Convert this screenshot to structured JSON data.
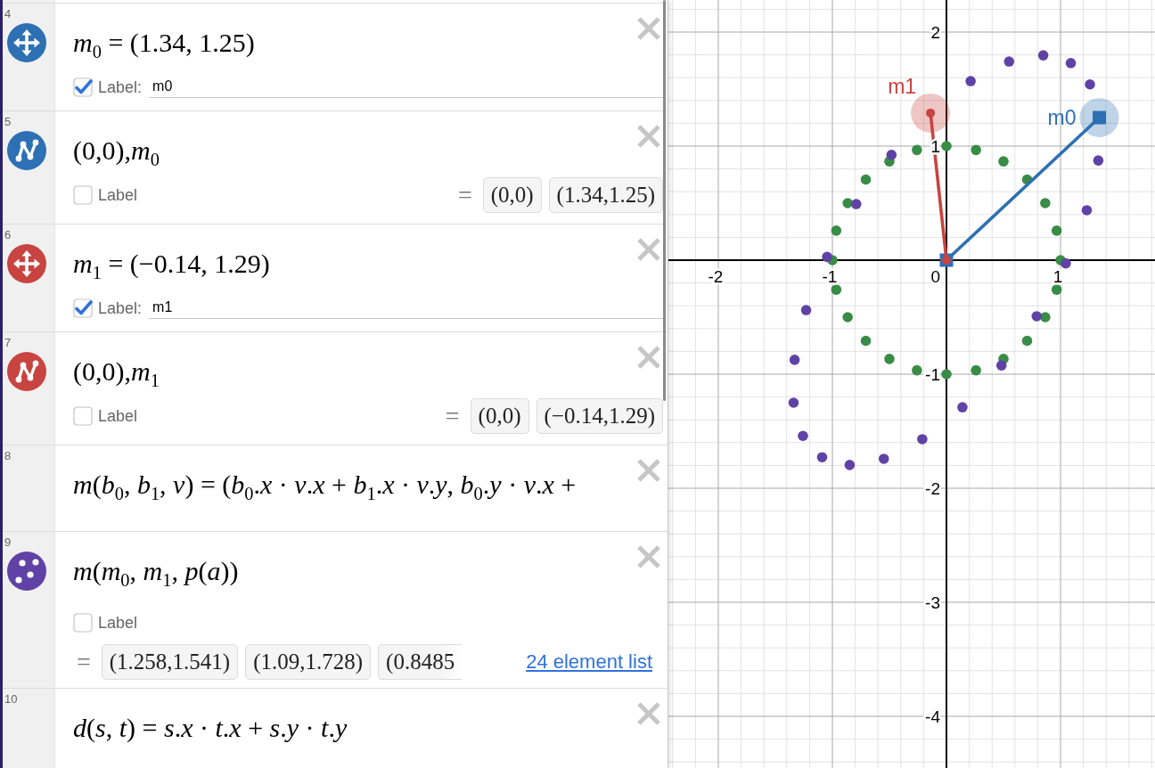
{
  "expressions": [
    {
      "number": "4",
      "kind": "point",
      "color": "#2d70b3",
      "math": "*m*$_{0}$ = (1.34, 1.25)",
      "label": {
        "checked": true,
        "text": "Label:",
        "value": "m0"
      }
    },
    {
      "number": "5",
      "kind": "polyline",
      "color": "#2d70b3",
      "math": "(0,0),*m*$_{0}$",
      "label": {
        "checked": false,
        "text": "Label"
      },
      "results": {
        "sign": "=",
        "values": [
          "(0,0)",
          "(1.34,1.25)"
        ]
      }
    },
    {
      "number": "6",
      "kind": "point",
      "color": "#c74440",
      "math": "*m*$_{1}$ = (−0.14, 1.29)",
      "label": {
        "checked": true,
        "text": "Label:",
        "value": "m1"
      }
    },
    {
      "number": "7",
      "kind": "polyline",
      "color": "#c74440",
      "math": "(0,0),*m*$_{1}$",
      "label": {
        "checked": false,
        "text": "Label"
      },
      "results": {
        "sign": "=",
        "values": [
          "(0,0)",
          "(−0.14,1.29)"
        ]
      }
    },
    {
      "number": "8",
      "kind": "function",
      "math": "*m*(*b*$_{0}$, *b*$_{1}$, *v*) = (*b*$_{0}$.*x* · *v*.*x* + *b*$_{1}$.*x* · *v*.*y*, *b*$_{0}$.*y* · *v*.*x* +"
    },
    {
      "number": "9",
      "kind": "points",
      "color": "#6042a6",
      "math": "*m*(*m*$_{0}$, *m*$_{1}$, *p*(*a*))",
      "label": {
        "checked": false,
        "text": "Label"
      },
      "results": {
        "sign": "=",
        "values": [
          "(1.258,1.541)",
          "(1.09,1.728)",
          "(0.8485"
        ],
        "link": "24 element list"
      }
    },
    {
      "number": "10",
      "kind": "function",
      "math": "*d*(*s*, *t*) = *s*.*x* · *t*.*x* + *s*.*y* · *t*.*y*"
    }
  ],
  "graph": {
    "chart_data": {
      "type": "scatter",
      "grid": true,
      "xlim": [
        -2.4375,
        1.828125
      ],
      "ylim": [
        -4.453125,
        2.28125
      ],
      "xticks": [
        -2,
        -1,
        0,
        1
      ],
      "yticks": [
        -4,
        -3,
        -2,
        -1,
        1,
        2
      ],
      "series": [
        {
          "color": "#388c46",
          "x": [
            0.966,
            0.866,
            0.707,
            0.5,
            0.259,
            0,
            -0.259,
            -0.5,
            -0.707,
            -0.866,
            -0.966,
            -1,
            -0.966,
            -0.866,
            -0.707,
            -0.5,
            -0.259,
            0,
            0.259,
            0.5,
            0.707,
            0.866,
            0.966,
            1
          ],
          "values": [
            0.259,
            0.5,
            0.707,
            0.866,
            0.966,
            1,
            0.966,
            0.866,
            0.707,
            0.5,
            0.259,
            0,
            -0.259,
            -0.5,
            -0.707,
            -0.866,
            -0.966,
            -1,
            -0.966,
            -0.866,
            -0.707,
            -0.5,
            -0.259,
            0
          ]
        },
        {
          "color": "#6042a6",
          "x": [
            1.258,
            1.09,
            0.8485,
            0.549,
            0.212,
            -0.482,
            -0.791,
            -1.046,
            -1.23,
            -1.331,
            -1.34,
            -1.258,
            -1.09,
            -0.8485,
            -0.549,
            -0.212,
            0.14,
            0.482,
            0.791,
            1.046,
            1.23,
            1.331
          ],
          "values": [
            1.541,
            1.728,
            1.796,
            1.742,
            1.57,
            0.923,
            0.492,
            0.028,
            -0.438,
            -0.874,
            -1.25,
            -1.541,
            -1.728,
            -1.796,
            -1.742,
            -1.57,
            -1.29,
            -0.923,
            -0.492,
            -0.028,
            0.438,
            0.874
          ]
        },
        {
          "name": "m0",
          "type": "line",
          "color": "#2d70b3",
          "marker": "square",
          "x": [
            0,
            1.34
          ],
          "values": [
            0,
            1.25
          ]
        },
        {
          "name": "m1",
          "type": "line",
          "color": "#c74440",
          "marker": "circle",
          "x": [
            0,
            -0.14
          ],
          "values": [
            0,
            1.29
          ]
        }
      ]
    }
  }
}
